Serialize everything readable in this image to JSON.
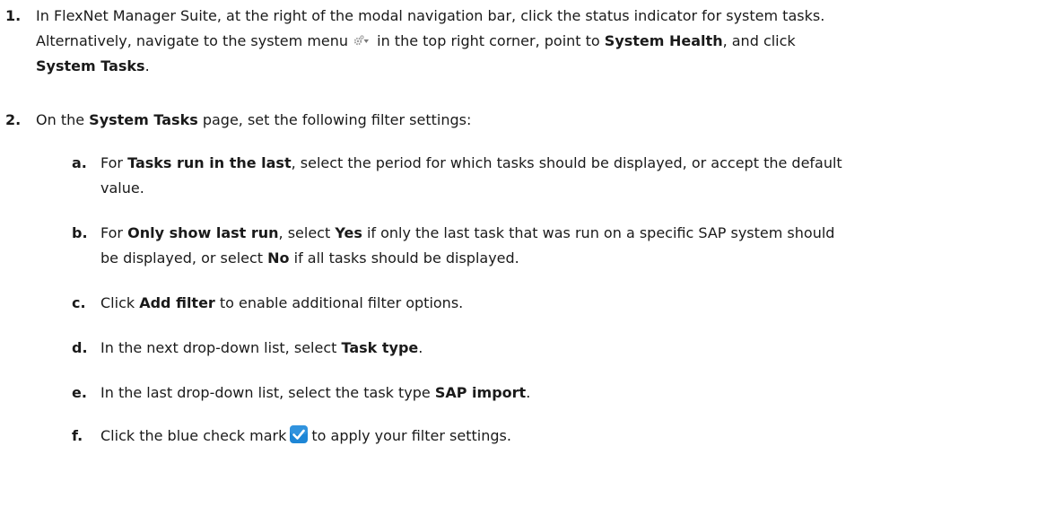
{
  "steps": [
    {
      "number": "1.",
      "line1": "In FlexNet Manager Suite, at the right of the modal navigation bar, click the status indicator for system tasks.",
      "line2a": "Alternatively, navigate to the system menu",
      "gear_icon": "gear-dropdown-icon",
      "line2b": "in the top right corner, point to",
      "line2_bold": "System Health",
      "line2c": ", and click",
      "line3_bold": "System Tasks",
      "line3_end": "."
    },
    {
      "number": "2.",
      "t1": "On the",
      "b1": "System Tasks",
      "t2": "page, set the following filter settings:",
      "substeps": [
        {
          "letter": "a.",
          "t1": "For",
          "b1": "Tasks run in the last",
          "t2": ", select the period for which tasks should be displayed, or accept the default",
          "t3": "value."
        },
        {
          "letter": "b.",
          "t1": "For",
          "b1": "Only show last run",
          "t2": ", select",
          "b2": "Yes",
          "t3": "if only the last task that was run on a specific SAP system should",
          "t4": "be displayed, or select",
          "b3": "No",
          "t5": "if all tasks should be displayed."
        },
        {
          "letter": "c.",
          "t1": "Click",
          "b1": "Add filter",
          "t2": "to enable additional filter options."
        },
        {
          "letter": "d.",
          "t1": "In the next drop-down list, select",
          "b1": "Task type",
          "t2": "."
        },
        {
          "letter": "e.",
          "t1": "In the last drop-down list, select the task type",
          "b1": "SAP import",
          "t2": "."
        },
        {
          "letter": "f.",
          "t1": "Click the blue check mark",
          "icon": "blue-check-icon",
          "t2": "to apply your filter settings.",
          "colors": {
            "check_bg": "#1e86d6"
          }
        }
      ]
    }
  ]
}
